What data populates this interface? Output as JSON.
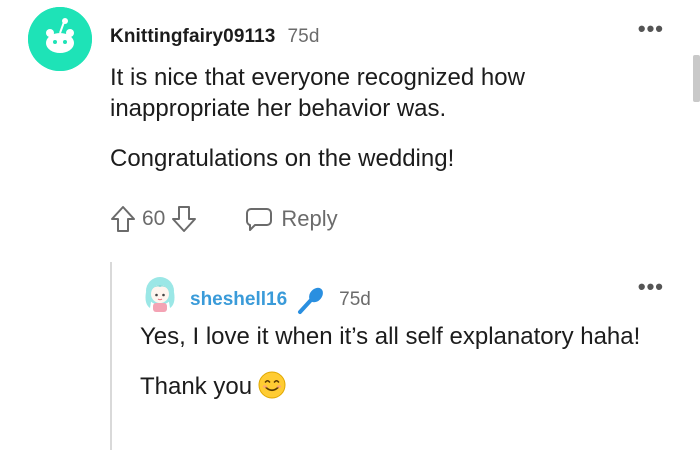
{
  "comment": {
    "author": "Knittingfairy09113",
    "age": "75d",
    "paragraphs": [
      "It is nice that everyone recognized how inappropriate her behavior was.",
      "Congratulations on the wedding!"
    ],
    "score": "60",
    "reply_label": "Reply"
  },
  "reply": {
    "author": "sheshell16",
    "age": "75d",
    "paragraph1": "Yes, I love it when it’s all self explanatory haha!",
    "paragraph2": "Thank you"
  },
  "colors": {
    "avatar_bg": "#1ee3b7",
    "reply_author": "#3a9bd9",
    "mic_icon": "#2a8fe0",
    "meta_gray": "#6b6b6b"
  },
  "icons": {
    "avatar": "reddit-snoo-avatar",
    "upvote": "arrow-up-outline",
    "downvote": "arrow-down-outline",
    "reply": "speech-bubble-outline",
    "mic": "microphone",
    "emoji": "smiling-face-emoji"
  }
}
